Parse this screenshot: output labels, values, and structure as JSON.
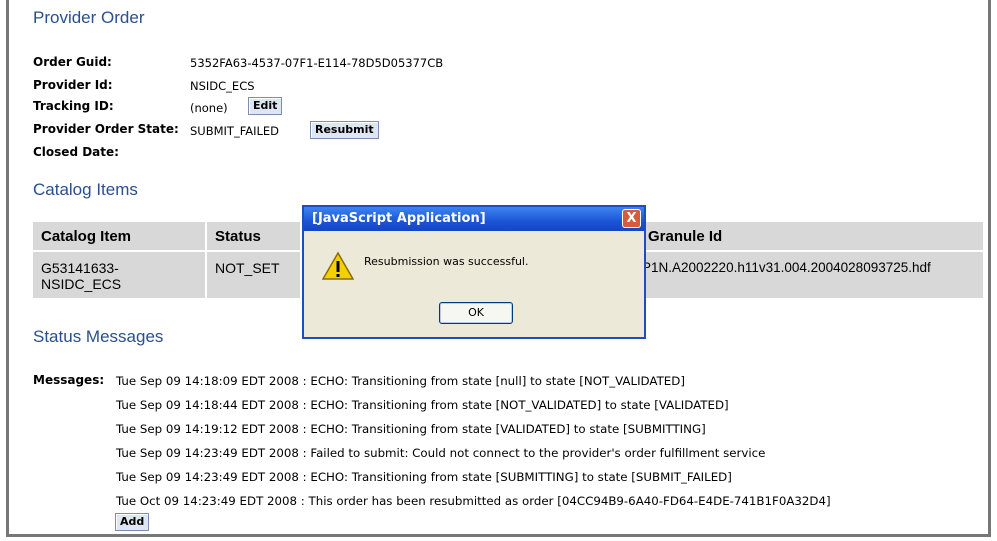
{
  "provider_order": {
    "heading": "Provider Order",
    "order_guid_label": "Order Guid:",
    "order_guid": "5352FA63-4537-07F1-E114-78D5D05377CB",
    "provider_id_label": "Provider Id:",
    "provider_id": "NSIDC_ECS",
    "tracking_id_label": "Tracking ID:",
    "tracking_id": "(none)",
    "edit_label": "Edit",
    "state_label": "Provider Order State:",
    "state": "SUBMIT_FAILED",
    "resubmit_label": "Resubmit",
    "closed_date_label": "Closed Date:"
  },
  "catalog": {
    "heading": "Catalog Items",
    "columns": [
      "Catalog Item",
      "Status",
      "",
      "Granule Id"
    ],
    "rows": [
      {
        "item_line1": "G53141633-",
        "item_line2": "NSIDC_ECS",
        "status": "NOT_SET",
        "granule": "P1N.A2002220.h11v31.004.2004028093725.hdf"
      }
    ]
  },
  "status_messages": {
    "heading": "Status Messages",
    "label": "Messages:",
    "messages": [
      "Tue Sep 09 14:18:09 EDT 2008 : ECHO: Transitioning from state [null] to state [NOT_VALIDATED]",
      "Tue Sep 09 14:18:44 EDT 2008 : ECHO: Transitioning from state [NOT_VALIDATED] to state [VALIDATED]",
      "Tue Sep 09 14:19:12 EDT 2008 : ECHO: Transitioning from state [VALIDATED] to state [SUBMITTING]",
      "Tue Sep 09 14:23:49 EDT 2008 : Failed to submit: Could not connect to the provider's order fulfillment service",
      "Tue Sep 09 14:23:49 EDT 2008 : ECHO: Transitioning from state [SUBMITTING] to state [SUBMIT_FAILED]",
      "Tue Oct 09 14:23:49 EDT 2008 : This order has been resubmitted as order [04CC94B9-6A40-FD64-E4DE-741B1F0A32D4]"
    ],
    "add_label": "Add"
  },
  "dialog": {
    "title": "[JavaScript Application]",
    "close": "X",
    "message": "Resubmission was successful.",
    "ok_label": "OK",
    "icon": "warning-icon"
  },
  "colors": {
    "heading": "#2a4f8f",
    "titlebar": "#1a55d6",
    "table_bg": "#d8d8d8"
  }
}
